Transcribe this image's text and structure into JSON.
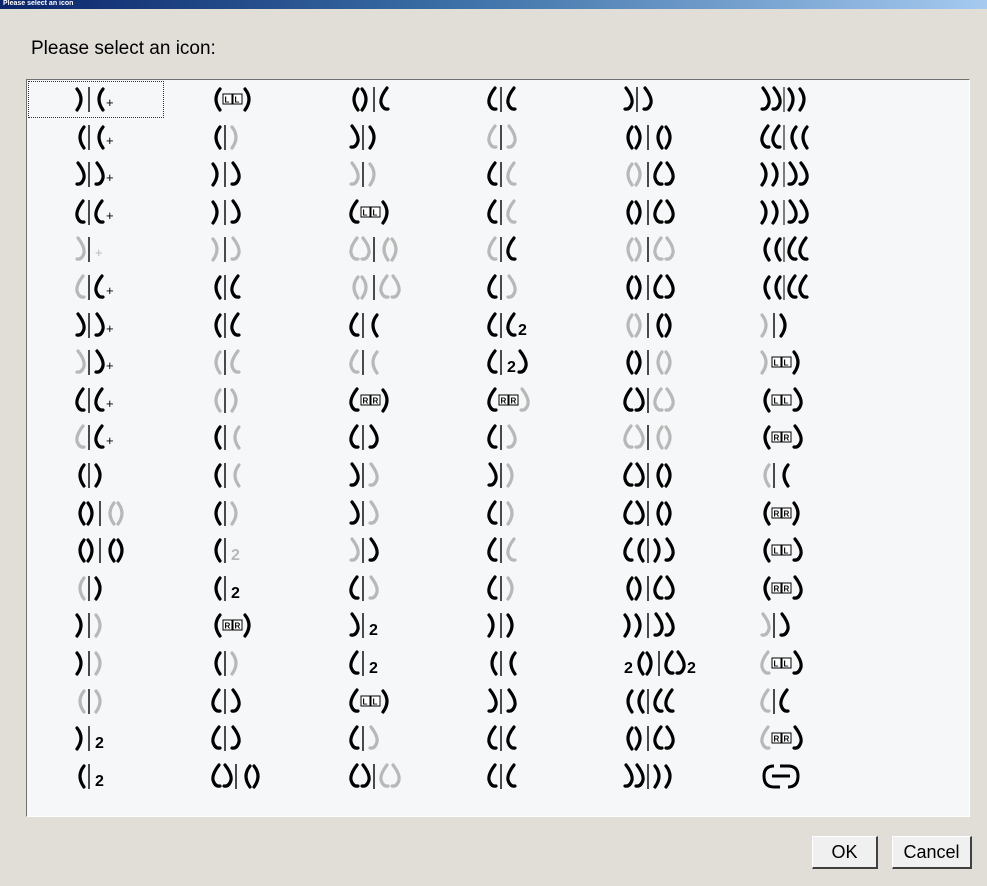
{
  "window": {
    "title": "Please select an icon",
    "prompt": "Please select an icon:"
  },
  "buttons": {
    "ok": "OK",
    "cancel": "Cancel"
  },
  "icon_grid": {
    "columns": 6,
    "rows": 19,
    "selected": [
      0,
      0
    ],
    "cells": [
      [
        [
          "R",
          "|",
          "L+"
        ],
        [
          "L",
          "LL",
          "R"
        ],
        [
          "LR",
          "|",
          "C"
        ],
        [
          "C",
          "|",
          "C"
        ],
        [
          "S",
          "|",
          "S"
        ],
        [
          "SS",
          "||",
          "RR"
        ]
      ],
      [
        [
          "L",
          "|",
          "L+"
        ],
        [
          "L",
          "|",
          "R~"
        ],
        [
          "S",
          "|",
          "R"
        ],
        [
          "C~",
          "|",
          "S~"
        ],
        [
          "LR",
          "|",
          "LR"
        ],
        [
          "CC",
          "||",
          "LL"
        ]
      ],
      [
        [
          "S",
          "|",
          "S+"
        ],
        [
          "R",
          "|",
          "S"
        ],
        [
          "S~",
          "|",
          "R~"
        ],
        [
          "C",
          "|",
          "C~"
        ],
        [
          "LR~",
          "|",
          "CS"
        ],
        [
          "RR",
          "||",
          "SS"
        ]
      ],
      [
        [
          "C",
          "|",
          "C+"
        ],
        [
          "R",
          "|",
          "S"
        ],
        [
          "C",
          "LL",
          "R"
        ],
        [
          "C",
          "|",
          "C~"
        ],
        [
          "LR",
          "|",
          "CS"
        ],
        [
          "RR",
          "||",
          "SS"
        ]
      ],
      [
        [
          "S~",
          "|",
          "+~"
        ],
        [
          "R~",
          "|",
          "S~"
        ],
        [
          "CS~",
          "|",
          "LR~"
        ],
        [
          "C~",
          "|",
          "C"
        ],
        [
          "LR~",
          "|",
          "CS~"
        ],
        [
          "LL",
          "||",
          "CC"
        ]
      ],
      [
        [
          "C~",
          "|",
          "C+"
        ],
        [
          "L",
          "|",
          "C"
        ],
        [
          "LR~",
          "|",
          "CS~"
        ],
        [
          "C",
          "|",
          "S~"
        ],
        [
          "LR",
          "|",
          "CS"
        ],
        [
          "LL",
          "||",
          "CC"
        ]
      ],
      [
        [
          "S",
          "|",
          "S+"
        ],
        [
          "L",
          "|",
          "C"
        ],
        [
          "C",
          "|",
          "L"
        ],
        [
          "C",
          "|",
          "C2"
        ],
        [
          "LR~",
          "|",
          "LR"
        ],
        [
          "R~",
          "|",
          "R"
        ]
      ],
      [
        [
          "S~",
          "|",
          "S+"
        ],
        [
          "L~",
          "|",
          "C~"
        ],
        [
          "C~",
          "|",
          "L~"
        ],
        [
          "C",
          "|",
          "2S"
        ],
        [
          "LR",
          "|",
          "LR~"
        ],
        [
          "R~",
          "LL",
          "R"
        ]
      ],
      [
        [
          "C",
          "|",
          "C+"
        ],
        [
          "L~",
          "|",
          "R~"
        ],
        [
          "C",
          "RR",
          "R"
        ],
        [
          "C",
          "RR",
          "S~"
        ],
        [
          "CS",
          "|",
          "CS~"
        ],
        [
          "L",
          "LL",
          "S"
        ]
      ],
      [
        [
          "C~",
          "|",
          "C+"
        ],
        [
          "L",
          "|",
          "L~"
        ],
        [
          "C",
          "|",
          "S"
        ],
        [
          "C",
          "|",
          "S~"
        ],
        [
          "CS~",
          "|",
          "LR~"
        ],
        [
          "L",
          "RR",
          "S"
        ]
      ],
      [
        [
          "L",
          "|",
          "R"
        ],
        [
          "L",
          "|",
          "L~"
        ],
        [
          "S",
          "|",
          "S~"
        ],
        [
          "S",
          "|",
          "R~"
        ],
        [
          "CS",
          "|",
          "LR"
        ],
        [
          "L~",
          "|",
          "L"
        ]
      ],
      [
        [
          "LR",
          "|",
          "LR~"
        ],
        [
          "L",
          "|",
          "R~"
        ],
        [
          "S",
          "|",
          "S~"
        ],
        [
          "C",
          "|",
          "R~"
        ],
        [
          "CS",
          "|",
          "LR"
        ],
        [
          "L",
          "RR",
          "R"
        ]
      ],
      [
        [
          "LR",
          "|",
          "LR"
        ],
        [
          "L",
          "|",
          "2~"
        ],
        [
          "S~",
          "|",
          "S"
        ],
        [
          "C",
          "|",
          "C~"
        ],
        [
          "CL",
          "|",
          "RS"
        ],
        [
          "L",
          "LL",
          "S"
        ]
      ],
      [
        [
          "L~",
          "|",
          "R"
        ],
        [
          "L",
          "|",
          "2"
        ],
        [
          "C",
          "|",
          "S~"
        ],
        [
          "C",
          "|",
          "R~"
        ],
        [
          "LR",
          "|",
          "CS"
        ],
        [
          "L",
          "RR",
          "S"
        ]
      ],
      [
        [
          "R",
          "|",
          "R~"
        ],
        [
          "L",
          "RR",
          "R"
        ],
        [
          "S",
          "|",
          "2"
        ],
        [
          "R",
          "|",
          "R"
        ],
        [
          "RR",
          "|",
          "SS"
        ],
        [
          "S~",
          "|",
          "S"
        ]
      ],
      [
        [
          "R",
          "|",
          "R~"
        ],
        [
          "L",
          "|",
          "R~"
        ],
        [
          "C",
          "|",
          "2"
        ],
        [
          "L",
          "|",
          "L"
        ],
        [
          "2LR",
          "|",
          "CS2"
        ],
        [
          "C~",
          "LL",
          "S"
        ]
      ],
      [
        [
          "L~",
          "|",
          "R~"
        ],
        [
          "C",
          "|",
          "S"
        ],
        [
          "C",
          "LL",
          "R"
        ],
        [
          "S",
          "|",
          "S"
        ],
        [
          "LL",
          "|",
          "CC"
        ],
        [
          "C~",
          "|",
          "C"
        ]
      ],
      [
        [
          "R",
          "|",
          "2"
        ],
        [
          "C",
          "|",
          "S"
        ],
        [
          "C",
          "|",
          "S~"
        ],
        [
          "C",
          "|",
          "C"
        ],
        [
          "LR",
          "|",
          "CS"
        ],
        [
          "C~",
          "RR",
          "S"
        ]
      ],
      [
        [
          "L",
          "|",
          "2"
        ],
        [
          "CS",
          "|",
          "LR"
        ],
        [
          "CS",
          "|",
          "CS~"
        ],
        [
          "C",
          "|",
          "C"
        ],
        [
          "SS",
          "|",
          "RR"
        ],
        [
          "LINK",
          "",
          ""
        ]
      ]
    ]
  }
}
